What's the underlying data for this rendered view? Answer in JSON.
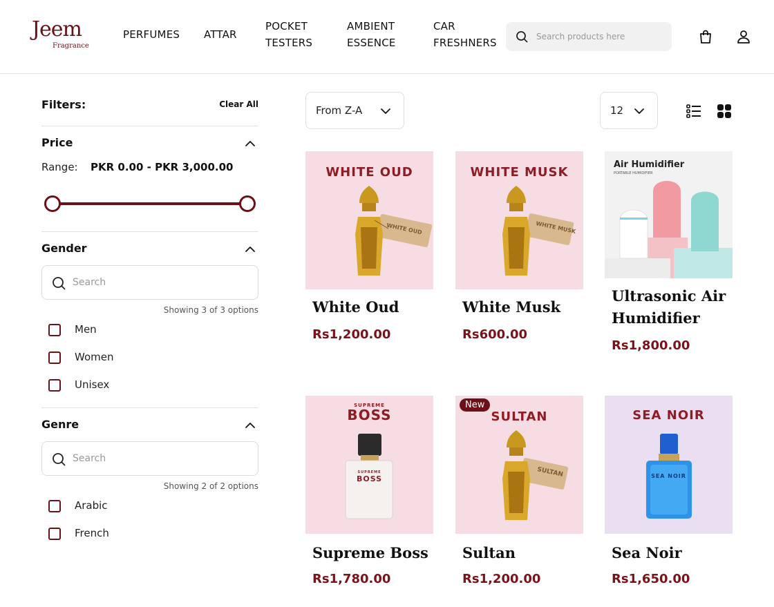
{
  "brand": {
    "logo_main": "Jeem",
    "logo_sub": "Fragrance",
    "color": "#6b1016"
  },
  "nav": [
    {
      "line1": "PERFUMES",
      "line2": ""
    },
    {
      "line1": "ATTAR",
      "line2": ""
    },
    {
      "line1": "POCKET",
      "line2": "TESTERS"
    },
    {
      "line1": "AMBIENT",
      "line2": "ESSENCE"
    },
    {
      "line1": "CAR",
      "line2": "FRESHNERS"
    }
  ],
  "search": {
    "placeholder": "Search products here",
    "icon": "search-icon"
  },
  "header_icons": [
    "shopping-bag-icon",
    "user-icon"
  ],
  "filters": {
    "title": "Filters:",
    "clear_all": "Clear All",
    "price": {
      "title": "Price",
      "range_label": "Range:",
      "range_value": "PKR 0.00 - PKR 3,000.00",
      "min_fraction": 0,
      "max_fraction": 1
    },
    "gender": {
      "title": "Gender",
      "search_placeholder": "Search",
      "showing": "Showing 3 of 3 options",
      "options": [
        "Men",
        "Women",
        "Unisex"
      ]
    },
    "genre": {
      "title": "Genre",
      "search_placeholder": "Search",
      "showing": "Showing 2 of 2 options",
      "options": [
        "Arabic",
        "French"
      ]
    }
  },
  "toolbar": {
    "sort_value": "From Z-A",
    "per_page": "12",
    "view_icons": [
      "list-view-icon",
      "grid-view-icon"
    ]
  },
  "products": [
    {
      "image_title": "WHITE OUD",
      "tag": "WHITE OUD",
      "name": "White Oud",
      "price": "Rs1,200.00"
    },
    {
      "image_title": "WHITE MUSK",
      "tag": "WHITE MUSK",
      "name": "White Musk",
      "price": "Rs600.00"
    },
    {
      "image_title": "Air Humidifier",
      "image_subtitle": "PORTABLE HUMIDIFIER",
      "name": "Ultrasonic Air Humidifier",
      "price": "Rs1,800.00"
    },
    {
      "image_title_small": "SUPREME",
      "image_title": "BOSS",
      "bottle_label_small": "SUPREME",
      "bottle_label": "BOSS",
      "name": "Supreme Boss",
      "price": "Rs1,780.00"
    },
    {
      "badge": "New",
      "image_title": "SULTAN",
      "tag": "SULTAN",
      "name": "Sultan",
      "price": "Rs1,200.00"
    },
    {
      "image_title": "SEA NOIR",
      "bottle_label": "SEA NOIR",
      "name": "Sea Noir",
      "price": "Rs1,650.00"
    }
  ]
}
